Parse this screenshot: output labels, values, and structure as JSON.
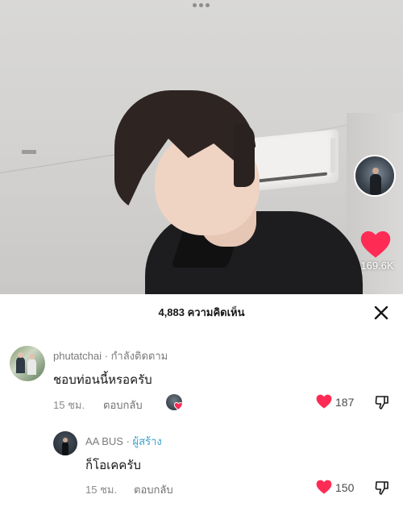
{
  "video": {
    "likes_count": "169.6K",
    "options_icon": "more-dots-icon"
  },
  "comments_sheet": {
    "title": "4,883 ความคิดเห็น",
    "close_icon": "close-icon",
    "comments": [
      {
        "username": "phutatchai",
        "separator": " · ",
        "status": "กำลังติดตาม",
        "text": "ชอบท่อนนี้หรอครับ",
        "time": "15 ชม.",
        "reply_label": "ตอบกลับ",
        "likes": "187",
        "liked_by_creator": true
      },
      {
        "username": "AA BUS",
        "separator": " · ",
        "status": "ผู้สร้าง",
        "text": "ก็โอเคครับ",
        "time": "15 ชม.",
        "reply_label": "ตอบกลับ",
        "likes": "150"
      }
    ]
  },
  "colors": {
    "like_red": "#fe2c55",
    "creator_badge": "#3aa0c9"
  }
}
